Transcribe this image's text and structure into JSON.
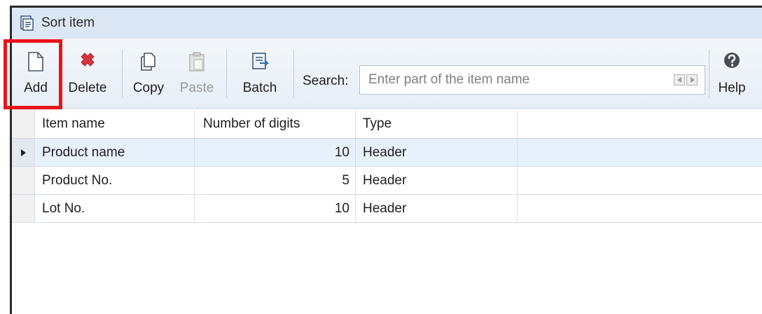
{
  "window": {
    "title": "Sort item",
    "title_icon": "sort-window-icon"
  },
  "toolbar": {
    "buttons": [
      {
        "label": "Add",
        "icon": "document-new-icon",
        "enabled": true
      },
      {
        "label": "Delete",
        "icon": "delete-x-icon",
        "enabled": true
      },
      {
        "label": "Copy",
        "icon": "copy-icon",
        "enabled": true
      },
      {
        "label": "Paste",
        "icon": "paste-icon",
        "enabled": false
      },
      {
        "label": "Batch",
        "icon": "batch-icon",
        "enabled": true
      },
      {
        "label": "Help",
        "icon": "help-icon",
        "enabled": true
      }
    ],
    "search": {
      "label": "Search:",
      "placeholder": "Enter part of the item name",
      "value": ""
    }
  },
  "grid": {
    "columns": [
      "Item name",
      "Number of digits",
      "Type"
    ],
    "rows": [
      {
        "item_name": "Product name",
        "digits": "10",
        "type": "Header",
        "selected": true
      },
      {
        "item_name": "Product No.",
        "digits": "5",
        "type": "Header",
        "selected": false
      },
      {
        "item_name": "Lot No.",
        "digits": "10",
        "type": "Header",
        "selected": false
      }
    ]
  },
  "colors": {
    "highlight": "#e8141c",
    "titlebar": "#dbe7f4",
    "selected_row": "#e7f1fb",
    "delete_icon": "#d9333f",
    "help_icon": "#4a4f57"
  }
}
